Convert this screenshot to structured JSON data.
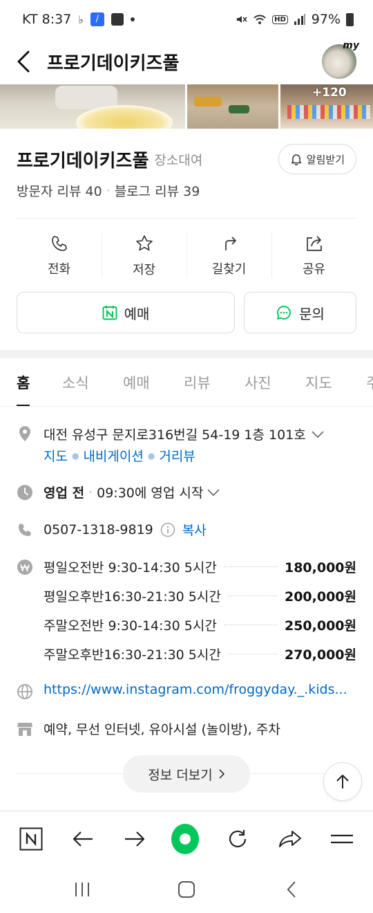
{
  "status_bar": {
    "carrier_time": "KT 8:37",
    "battery": "97%",
    "hd_label": "HD"
  },
  "header": {
    "title": "프로기데이키즈풀",
    "avatar_tag": "my"
  },
  "photos": {
    "more_count": "+120"
  },
  "place": {
    "name": "프로기데이키즈풀",
    "category": "장소대여",
    "notify_label": "알림받기",
    "visitor_reviews": "방문자 리뷰 40",
    "blog_reviews": "블로그 리뷰 39"
  },
  "actions": [
    {
      "label": "전화",
      "icon": "phone-icon"
    },
    {
      "label": "저장",
      "icon": "star-icon"
    },
    {
      "label": "길찾기",
      "icon": "directions-icon"
    },
    {
      "label": "공유",
      "icon": "share-icon"
    }
  ],
  "booking": {
    "reserve_label": "예매",
    "inquiry_label": "문의",
    "brand_color": "#03c75a"
  },
  "tabs": [
    {
      "label": "홈",
      "active": true
    },
    {
      "label": "소식"
    },
    {
      "label": "예매"
    },
    {
      "label": "리뷰"
    },
    {
      "label": "사진"
    },
    {
      "label": "지도"
    },
    {
      "label": "주"
    }
  ],
  "info": {
    "address": "대전 유성구 문지로316번길 54-19 1층 101호",
    "address_links": [
      "지도",
      "내비게이션",
      "거리뷰"
    ],
    "hours_status": "영업 전",
    "hours_detail": "09:30에 영업 시작",
    "phone": "0507-1318-9819",
    "copy_label": "복사",
    "prices": [
      {
        "name": "평일오전반 9:30-14:30 5시간",
        "amount": "180,000원"
      },
      {
        "name": "평일오후반16:30-21:30 5시간",
        "amount": "200,000원"
      },
      {
        "name": "주말오전반 9:30-14:30 5시간",
        "amount": "250,000원"
      },
      {
        "name": "주말오후반16:30-21:30 5시간",
        "amount": "270,000원"
      }
    ],
    "website": "https://www.instagram.com/froggyday._.kids...",
    "amenities": "예약, 무선 인터넷, 유아시설 (놀이방), 주차",
    "more_info_label": "정보 더보기"
  },
  "colors": {
    "link_blue": "#0068c3",
    "naver_green": "#03c75a"
  }
}
